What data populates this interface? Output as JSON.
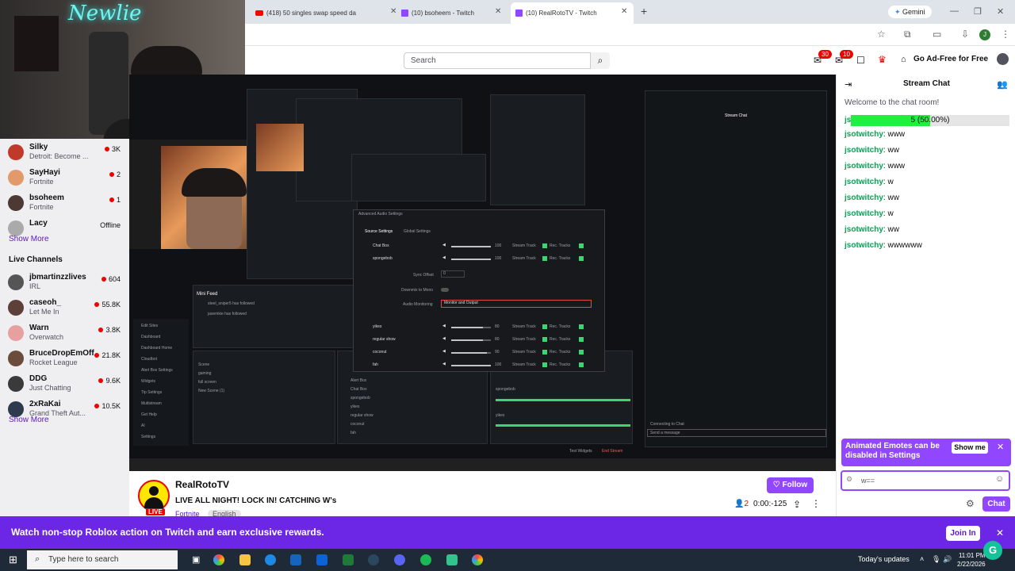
{
  "browser": {
    "tabs": [
      {
        "title": "(418) 50 singles swap speed da",
        "kind": "youtube"
      },
      {
        "title": "(10) bsoheem - Twitch",
        "kind": "twitch"
      },
      {
        "title": "(10) RealRotoTV - Twitch",
        "kind": "twitch",
        "active": true
      }
    ],
    "new_tab": "+",
    "gemini": "Gemini",
    "profile_initial": "J"
  },
  "webcam": {
    "neon_sign": "Newlie"
  },
  "twitch_nav": {
    "search_placeholder": "Search",
    "notifications_count": "30",
    "inbox_count": "10",
    "ad_free": "Go Ad-Free for Free"
  },
  "sidebar": {
    "followed": [
      {
        "name": "Silky",
        "game": "Detroit: Become ...",
        "viewers": "3K",
        "color": "#c0392b"
      },
      {
        "name": "SayHayi",
        "game": "Fortnite",
        "viewers": "2",
        "color": "#e39a6b"
      },
      {
        "name": "bsoheem",
        "game": "Fortnite",
        "viewers": "1",
        "color": "#4a3a33"
      },
      {
        "name": "Lacy",
        "game": "",
        "viewers": "Offline",
        "color": "#aaaaaa"
      }
    ],
    "show_more_1": "Show More",
    "live_channels_heading": "Live Channels",
    "live": [
      {
        "name": "jbmartinzzlives",
        "game": "IRL",
        "viewers": "604",
        "color": "#555555"
      },
      {
        "name": "caseoh_",
        "game": "Let Me In",
        "viewers": "55.8K",
        "color": "#5d4037"
      },
      {
        "name": "Warn",
        "game": "Overwatch",
        "viewers": "3.8K",
        "color": "#e6a0a0"
      },
      {
        "name": "BruceDropEmOff",
        "game": "Rocket League",
        "viewers": "21.8K",
        "color": "#6b4b3a"
      },
      {
        "name": "DDG",
        "game": "Just Chatting",
        "viewers": "9.6K",
        "color": "#3a3a3a"
      },
      {
        "name": "2xRaKai",
        "game": "Grand Theft Aut...",
        "viewers": "10.5K",
        "color": "#2e3b4e"
      }
    ],
    "show_more_2": "Show More"
  },
  "video": {
    "obs_dialog_title": "Advanced Audio Settings",
    "obs_tabs": [
      "Source Settings",
      "Global Settings"
    ],
    "audio_sources": [
      {
        "name": "Chat Box",
        "volume": "100"
      },
      {
        "name": "spongebob",
        "volume": "100"
      },
      {
        "name": "yikes",
        "volume": "80"
      },
      {
        "name": "regular show",
        "volume": "80"
      },
      {
        "name": "coconut",
        "volume": "90"
      },
      {
        "name": "fah",
        "volume": "100"
      }
    ],
    "sync_offset_label": "Sync Offset",
    "sync_offset_value": "0",
    "downmix_label": "Downmix to Mono",
    "monitoring_label": "Audio Monitoring",
    "monitoring_value": "Monitor and Output",
    "stream_track": "Stream Track",
    "rec_tracks": "Rec. Tracks",
    "mini_feed": "Mini Feed",
    "feed_items": [
      "steel_sniper5 has followed",
      "jasemkie has followed"
    ],
    "scenes": [
      "Scene",
      "gaming",
      "full screen",
      "New Scene (1)"
    ],
    "sources": [
      "Alert Box",
      "Chat Box",
      "spongebob",
      "yikes",
      "regular show",
      "coconut",
      "fah"
    ],
    "stream_chat_label": "Stream Chat",
    "connecting": "Connecting to Chat",
    "send_message": "Send a message",
    "end_stream": "End Stream",
    "test_widgets": "Test Widgets",
    "menu_items": [
      "Edit Sites",
      "Dashboard",
      "Dashboard Home",
      "Cloudbot",
      "Alert Box Settings",
      "Widgets",
      "Tip Settings",
      "Multistream",
      "Get Help",
      "AI",
      "Settings"
    ]
  },
  "stream": {
    "name": "RealRotoTV",
    "title": "LIVE ALL NIGHT! LOCK IN! CATCHING W's",
    "category": "Fortnite",
    "tag": "English",
    "live": "LIVE",
    "follow": "Follow",
    "viewers": "2",
    "uptime": "0:00:-125"
  },
  "chat": {
    "header": "Stream Chat",
    "welcome": "Welcome to the chat room!",
    "poll": {
      "label": "5 (50.00%)",
      "fraction": 0.5
    },
    "messages": [
      {
        "user": "jsotwitchy",
        "text": "www"
      },
      {
        "user": "jsotwitchy",
        "text": "ww"
      },
      {
        "user": "jsotwitchy",
        "text": "www"
      },
      {
        "user": "jsotwitchy",
        "text": "w"
      },
      {
        "user": "jsotwitchy",
        "text": "ww"
      },
      {
        "user": "jsotwitchy",
        "text": "w"
      },
      {
        "user": "jsotwitchy",
        "text": "ww"
      },
      {
        "user": "jsotwitchy",
        "text": "wwwwww"
      }
    ],
    "toast": "Animated Emotes can be disabled in Settings",
    "show_me": "Show me",
    "input_value": "w==",
    "send": "Chat"
  },
  "banner": {
    "text": "Watch non-stop Roblox action on Twitch and earn exclusive rewards.",
    "join": "Join In"
  },
  "taskbar": {
    "search_placeholder": "Type here to search",
    "news": "Today's updates",
    "time": "11:01 PM",
    "date": "2/22/2026"
  },
  "colors": {
    "twitch_purple": "#9147ff",
    "live_red": "#eb0400",
    "chat_green": "#00a651"
  }
}
